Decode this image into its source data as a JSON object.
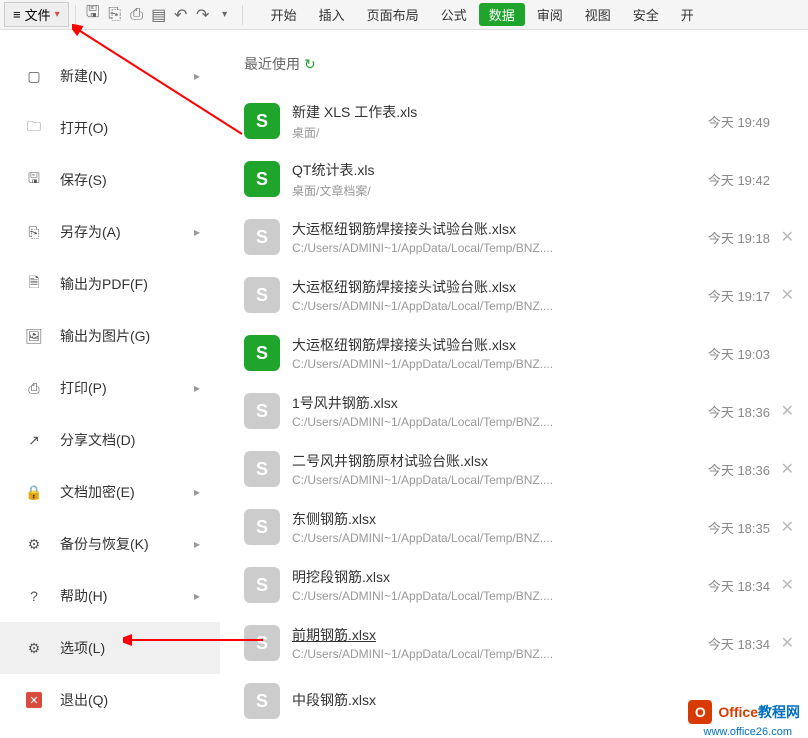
{
  "toolbar": {
    "file_label": "文件"
  },
  "tabs": [
    "开始",
    "插入",
    "页面布局",
    "公式",
    "数据",
    "审阅",
    "视图",
    "安全",
    "开"
  ],
  "active_tab": "数据",
  "sidebar": {
    "items": [
      {
        "label": "新建(N)",
        "icon": "new-file-icon",
        "chev": true
      },
      {
        "label": "打开(O)",
        "icon": "open-folder-icon",
        "chev": false
      },
      {
        "label": "保存(S)",
        "icon": "save-icon",
        "chev": false
      },
      {
        "label": "另存为(A)",
        "icon": "save-as-icon",
        "chev": true
      },
      {
        "label": "输出为PDF(F)",
        "icon": "export-pdf-icon",
        "chev": false
      },
      {
        "label": "输出为图片(G)",
        "icon": "export-image-icon",
        "chev": false
      },
      {
        "label": "打印(P)",
        "icon": "print-icon",
        "chev": true
      },
      {
        "label": "分享文档(D)",
        "icon": "share-icon",
        "chev": false
      },
      {
        "label": "文档加密(E)",
        "icon": "encrypt-icon",
        "chev": true
      },
      {
        "label": "备份与恢复(K)",
        "icon": "backup-icon",
        "chev": true
      },
      {
        "label": "帮助(H)",
        "icon": "help-icon",
        "chev": true
      },
      {
        "label": "选项(L)",
        "icon": "settings-icon",
        "chev": false
      },
      {
        "label": "退出(Q)",
        "icon": "exit-icon",
        "chev": false
      }
    ]
  },
  "recent_header": "最近使用",
  "files": [
    {
      "name": "新建 XLS 工作表.xls",
      "path": "桌面/",
      "time": "今天 19:49",
      "green": true,
      "close": false
    },
    {
      "name": "QT统计表.xls",
      "path": "桌面/文章档案/",
      "time": "今天 19:42",
      "green": true,
      "close": false
    },
    {
      "name": "大运枢纽钢筋焊接接头试验台账.xlsx",
      "path": "C:/Users/ADMINI~1/AppData/Local/Temp/BNZ....",
      "time": "今天 19:18",
      "green": false,
      "close": true
    },
    {
      "name": "大运枢纽钢筋焊接接头试验台账.xlsx",
      "path": "C:/Users/ADMINI~1/AppData/Local/Temp/BNZ....",
      "time": "今天 19:17",
      "green": false,
      "close": true
    },
    {
      "name": "大运枢纽钢筋焊接接头试验台账.xlsx",
      "path": "C:/Users/ADMINI~1/AppData/Local/Temp/BNZ....",
      "time": "今天 19:03",
      "green": true,
      "close": false
    },
    {
      "name": "1号风井钢筋.xlsx",
      "path": "C:/Users/ADMINI~1/AppData/Local/Temp/BNZ....",
      "time": "今天 18:36",
      "green": false,
      "close": true
    },
    {
      "name": "二号风井钢筋原材试验台账.xlsx",
      "path": "C:/Users/ADMINI~1/AppData/Local/Temp/BNZ....",
      "time": "今天 18:36",
      "green": false,
      "close": true
    },
    {
      "name": "东侧钢筋.xlsx",
      "path": "C:/Users/ADMINI~1/AppData/Local/Temp/BNZ....",
      "time": "今天 18:35",
      "green": false,
      "close": true
    },
    {
      "name": "明挖段钢筋.xlsx",
      "path": "C:/Users/ADMINI~1/AppData/Local/Temp/BNZ....",
      "time": "今天 18:34",
      "green": false,
      "close": true
    },
    {
      "name": "前期钢筋.xlsx",
      "path": "C:/Users/ADMINI~1/AppData/Local/Temp/BNZ....",
      "time": "今天 18:34",
      "green": false,
      "close": true,
      "underline": true
    },
    {
      "name": "中段钢筋.xlsx",
      "path": "",
      "time": "",
      "green": false,
      "close": false
    }
  ],
  "watermark": {
    "t1": "Office",
    "t2": "教程网",
    "url": "www.office26.com"
  }
}
